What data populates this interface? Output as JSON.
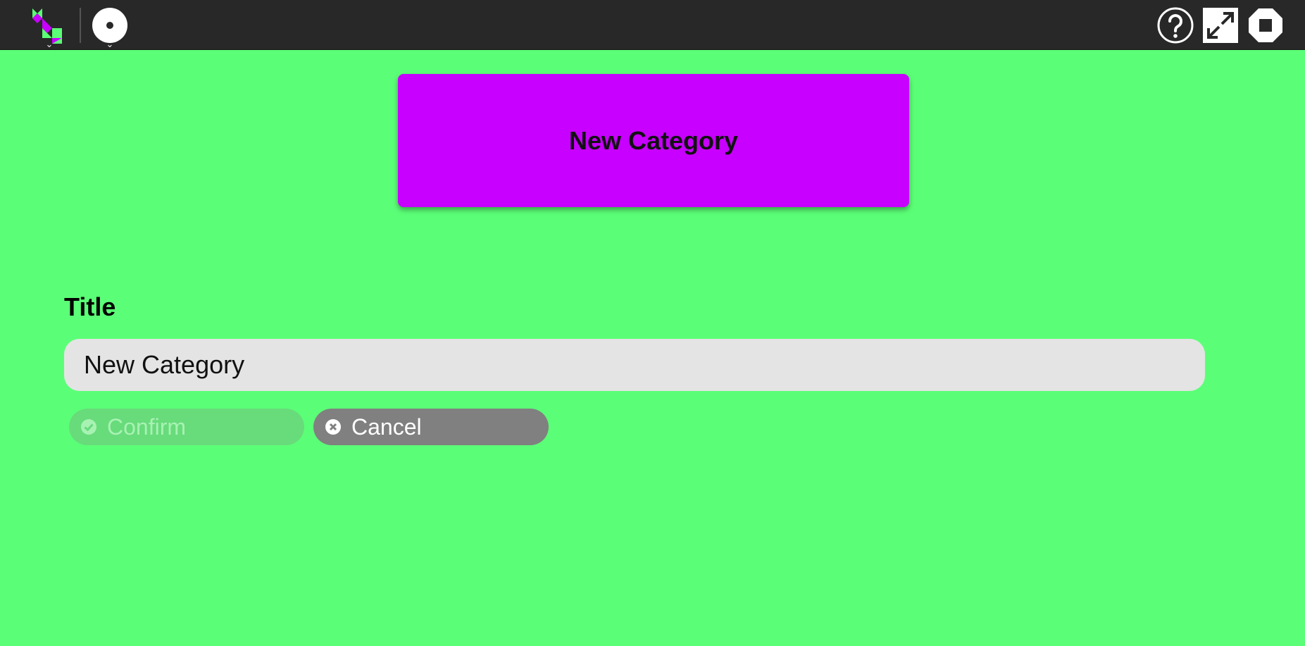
{
  "toolbar": {
    "activity_icon": "activity-logo-icon",
    "record_icon": "record-icon",
    "help_icon": "help-icon",
    "fullscreen_icon": "fullscreen-icon",
    "stop_icon": "stop-icon"
  },
  "header": {
    "tile_text": "New Category",
    "tile_color": "#c800ff"
  },
  "form": {
    "title_label": "Title",
    "title_value": "New Category",
    "confirm_label": "Confirm",
    "cancel_label": "Cancel"
  },
  "colors": {
    "background": "#5bff77",
    "toolbar": "#282828",
    "input": "#e4e4e4",
    "confirm": "#68db7b",
    "cancel": "#808080"
  }
}
